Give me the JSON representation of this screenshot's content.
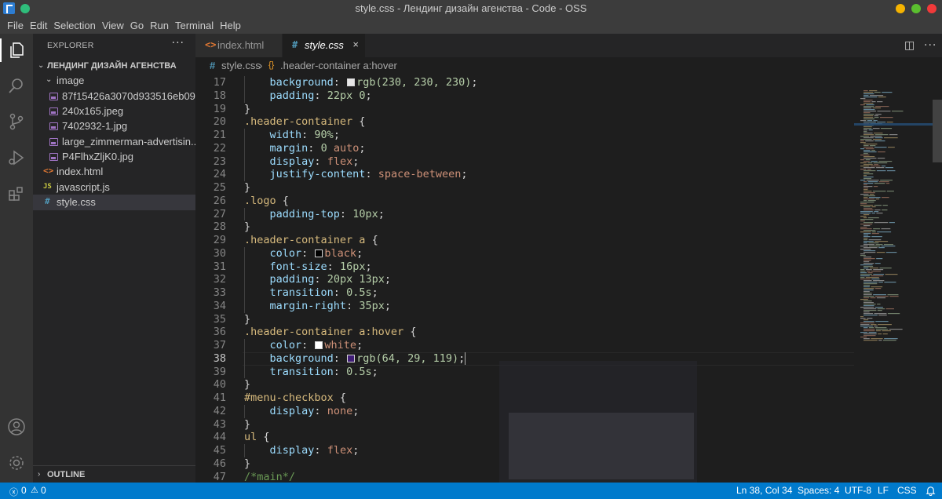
{
  "window": {
    "title": "style.css - Лендинг дизайн агенства - Code - OSS"
  },
  "menu": [
    "File",
    "Edit",
    "Selection",
    "View",
    "Go",
    "Run",
    "Terminal",
    "Help"
  ],
  "activity_icons": [
    "explorer-icon",
    "search-icon",
    "source-control-icon",
    "run-debug-icon",
    "extensions-icon",
    "account-icon",
    "settings-gear-icon"
  ],
  "sidebar": {
    "header": "EXPLORER",
    "more": "···",
    "project": "ЛЕНДИНГ ДИЗАЙН АГЕНСТВА",
    "folder": "image",
    "images": [
      "87f15426a3070d933516eb09...",
      "240x165.jpeg",
      "7402932-1.jpg",
      "large_zimmerman-advertisin...",
      "P4FlhxZljK0.jpg"
    ],
    "files": [
      {
        "icon": "<>",
        "name": "index.html",
        "color": "#e37933"
      },
      {
        "icon": "JS",
        "name": "javascript.js",
        "color": "#cbcb41"
      },
      {
        "icon": "#",
        "name": "style.css",
        "color": "#519aba"
      }
    ],
    "outline": "OUTLINE"
  },
  "tabs": [
    {
      "icon": "<>",
      "label": "index.html",
      "active": false
    },
    {
      "icon": "#",
      "label": "style.css",
      "active": true,
      "close": "×"
    }
  ],
  "breadcrumb": {
    "file": "style.css",
    "separator": "›",
    "symbol": ".header-container a:hover"
  },
  "editor": {
    "current_line": 38,
    "lines": [
      {
        "n": "17",
        "indent": true,
        "tokens": [
          [
            "prop",
            "background"
          ],
          [
            "pun",
            ": "
          ],
          [
            "swatch",
            "#e6e6e6"
          ],
          [
            "num",
            "rgb(230, 230, 230)"
          ],
          [
            "pun",
            ";"
          ]
        ]
      },
      {
        "n": "18",
        "indent": true,
        "tokens": [
          [
            "prop",
            "padding"
          ],
          [
            "pun",
            ": "
          ],
          [
            "num",
            "22px 0"
          ],
          [
            "pun",
            ";"
          ]
        ]
      },
      {
        "n": "19",
        "indent": false,
        "tokens": [
          [
            "pun",
            "}"
          ]
        ]
      },
      {
        "n": "20",
        "indent": false,
        "tokens": [
          [
            "sel",
            ".header-container"
          ],
          [
            "pun",
            " {"
          ]
        ]
      },
      {
        "n": "21",
        "indent": true,
        "tokens": [
          [
            "prop",
            "width"
          ],
          [
            "pun",
            ": "
          ],
          [
            "num",
            "90%"
          ],
          [
            "pun",
            ";"
          ]
        ]
      },
      {
        "n": "22",
        "indent": true,
        "tokens": [
          [
            "prop",
            "margin"
          ],
          [
            "pun",
            ": "
          ],
          [
            "num",
            "0"
          ],
          [
            "pun",
            " "
          ],
          [
            "val",
            "auto"
          ],
          [
            "pun",
            ";"
          ]
        ]
      },
      {
        "n": "23",
        "indent": true,
        "tokens": [
          [
            "prop",
            "display"
          ],
          [
            "pun",
            ": "
          ],
          [
            "val",
            "flex"
          ],
          [
            "pun",
            ";"
          ]
        ]
      },
      {
        "n": "24",
        "indent": true,
        "tokens": [
          [
            "prop",
            "justify-content"
          ],
          [
            "pun",
            ": "
          ],
          [
            "val",
            "space-between"
          ],
          [
            "pun",
            ";"
          ]
        ]
      },
      {
        "n": "25",
        "indent": false,
        "tokens": [
          [
            "pun",
            "}"
          ]
        ]
      },
      {
        "n": "26",
        "indent": false,
        "tokens": [
          [
            "sel",
            ".logo"
          ],
          [
            "pun",
            " {"
          ]
        ]
      },
      {
        "n": "27",
        "indent": true,
        "tokens": [
          [
            "prop",
            "padding-top"
          ],
          [
            "pun",
            ": "
          ],
          [
            "num",
            "10px"
          ],
          [
            "pun",
            ";"
          ]
        ]
      },
      {
        "n": "28",
        "indent": false,
        "tokens": [
          [
            "pun",
            "}"
          ]
        ]
      },
      {
        "n": "29",
        "indent": false,
        "tokens": [
          [
            "sel",
            ".header-container a"
          ],
          [
            "pun",
            " {"
          ]
        ]
      },
      {
        "n": "30",
        "indent": true,
        "tokens": [
          [
            "prop",
            "color"
          ],
          [
            "pun",
            ": "
          ],
          [
            "swatch",
            "#000000"
          ],
          [
            "val",
            "black"
          ],
          [
            "pun",
            ";"
          ]
        ]
      },
      {
        "n": "31",
        "indent": true,
        "tokens": [
          [
            "prop",
            "font-size"
          ],
          [
            "pun",
            ": "
          ],
          [
            "num",
            "16px"
          ],
          [
            "pun",
            ";"
          ]
        ]
      },
      {
        "n": "32",
        "indent": true,
        "tokens": [
          [
            "prop",
            "padding"
          ],
          [
            "pun",
            ": "
          ],
          [
            "num",
            "20px 13px"
          ],
          [
            "pun",
            ";"
          ]
        ]
      },
      {
        "n": "33",
        "indent": true,
        "tokens": [
          [
            "prop",
            "transition"
          ],
          [
            "pun",
            ": "
          ],
          [
            "num",
            "0.5s"
          ],
          [
            "pun",
            ";"
          ]
        ]
      },
      {
        "n": "34",
        "indent": true,
        "tokens": [
          [
            "prop",
            "margin-right"
          ],
          [
            "pun",
            ": "
          ],
          [
            "num",
            "35px"
          ],
          [
            "pun",
            ";"
          ]
        ]
      },
      {
        "n": "35",
        "indent": false,
        "tokens": [
          [
            "pun",
            "}"
          ]
        ]
      },
      {
        "n": "36",
        "indent": false,
        "tokens": [
          [
            "sel",
            ".header-container a:hover"
          ],
          [
            "pun",
            " {"
          ]
        ]
      },
      {
        "n": "37",
        "indent": true,
        "tokens": [
          [
            "prop",
            "color"
          ],
          [
            "pun",
            ": "
          ],
          [
            "swatch",
            "#ffffff"
          ],
          [
            "val",
            "white"
          ],
          [
            "pun",
            ";"
          ]
        ]
      },
      {
        "n": "38",
        "indent": true,
        "tokens": [
          [
            "prop",
            "background"
          ],
          [
            "pun",
            ": "
          ],
          [
            "swatch",
            "#401d77"
          ],
          [
            "num",
            "rgb(64, 29, 119)"
          ],
          [
            "pun",
            ";"
          ]
        ]
      },
      {
        "n": "39",
        "indent": true,
        "tokens": [
          [
            "prop",
            "transition"
          ],
          [
            "pun",
            ": "
          ],
          [
            "num",
            "0.5s"
          ],
          [
            "pun",
            ";"
          ]
        ]
      },
      {
        "n": "40",
        "indent": false,
        "tokens": [
          [
            "pun",
            "}"
          ]
        ]
      },
      {
        "n": "41",
        "indent": false,
        "tokens": [
          [
            "sel",
            "#menu-checkbox"
          ],
          [
            "pun",
            " {"
          ]
        ]
      },
      {
        "n": "42",
        "indent": true,
        "tokens": [
          [
            "prop",
            "display"
          ],
          [
            "pun",
            ": "
          ],
          [
            "val",
            "none"
          ],
          [
            "pun",
            ";"
          ]
        ]
      },
      {
        "n": "43",
        "indent": false,
        "tokens": [
          [
            "pun",
            "}"
          ]
        ]
      },
      {
        "n": "44",
        "indent": false,
        "tokens": [
          [
            "sel",
            "ul"
          ],
          [
            "pun",
            " {"
          ]
        ]
      },
      {
        "n": "45",
        "indent": true,
        "tokens": [
          [
            "prop",
            "display"
          ],
          [
            "pun",
            ": "
          ],
          [
            "val",
            "flex"
          ],
          [
            "pun",
            ";"
          ]
        ]
      },
      {
        "n": "46",
        "indent": false,
        "tokens": [
          [
            "pun",
            "}"
          ]
        ]
      },
      {
        "n": "47",
        "indent": false,
        "tokens": [
          [
            "cmt",
            "/*main*/"
          ]
        ]
      }
    ]
  },
  "statusbar": {
    "errors": "0",
    "warnings": "0",
    "position": "Ln 38, Col 34",
    "spaces": "Spaces: 4",
    "encoding": "UTF-8",
    "eol": "LF",
    "language": "CSS"
  },
  "colors": {
    "accent": "#007acc",
    "titlebar": "#3c3c3c",
    "sidebar": "#252526",
    "editor": "#1e1e1e"
  }
}
